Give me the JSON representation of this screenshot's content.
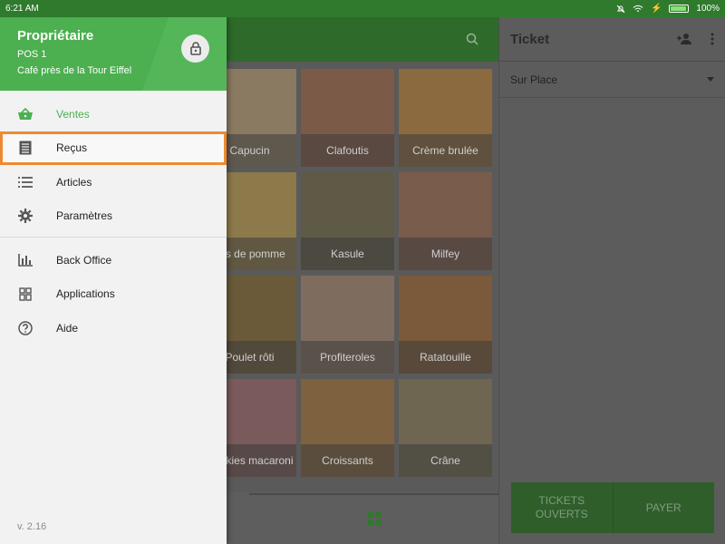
{
  "status_bar": {
    "time": "6:21 AM",
    "battery": "100%",
    "battery_level": 1.0
  },
  "drawer": {
    "owner": "Propriétaire",
    "pos": "POS 1",
    "store": "Café près de la Tour Eiffel",
    "menu": [
      {
        "label": "Ventes",
        "icon": "basket-icon",
        "active": true
      },
      {
        "label": "Reçus",
        "icon": "receipt-icon",
        "selected": true
      },
      {
        "label": "Articles",
        "icon": "list-icon"
      },
      {
        "label": "Paramètres",
        "icon": "gear-icon"
      },
      {
        "label": "Back Office",
        "icon": "bar-chart-icon"
      },
      {
        "label": "Applications",
        "icon": "apps-icon"
      },
      {
        "label": "Aide",
        "icon": "help-icon"
      }
    ],
    "version": "v. 2.16"
  },
  "items": [
    "Capucin",
    "Clafoutis",
    "Crème brulée",
    "Jus de pomme",
    "Kasule",
    "Milfey",
    "Poulet rôti",
    "Profiteroles",
    "Ratatouille",
    "Cookies macaroni",
    "Croissants",
    "Crâne"
  ],
  "ticket": {
    "title": "Ticket",
    "dining_option": "Sur Place",
    "open_tickets": "TICKETS OUVERTS",
    "pay": "PAYER"
  },
  "colors": {
    "brand_green": "#4caf50",
    "selection_orange": "#ee8a32"
  }
}
